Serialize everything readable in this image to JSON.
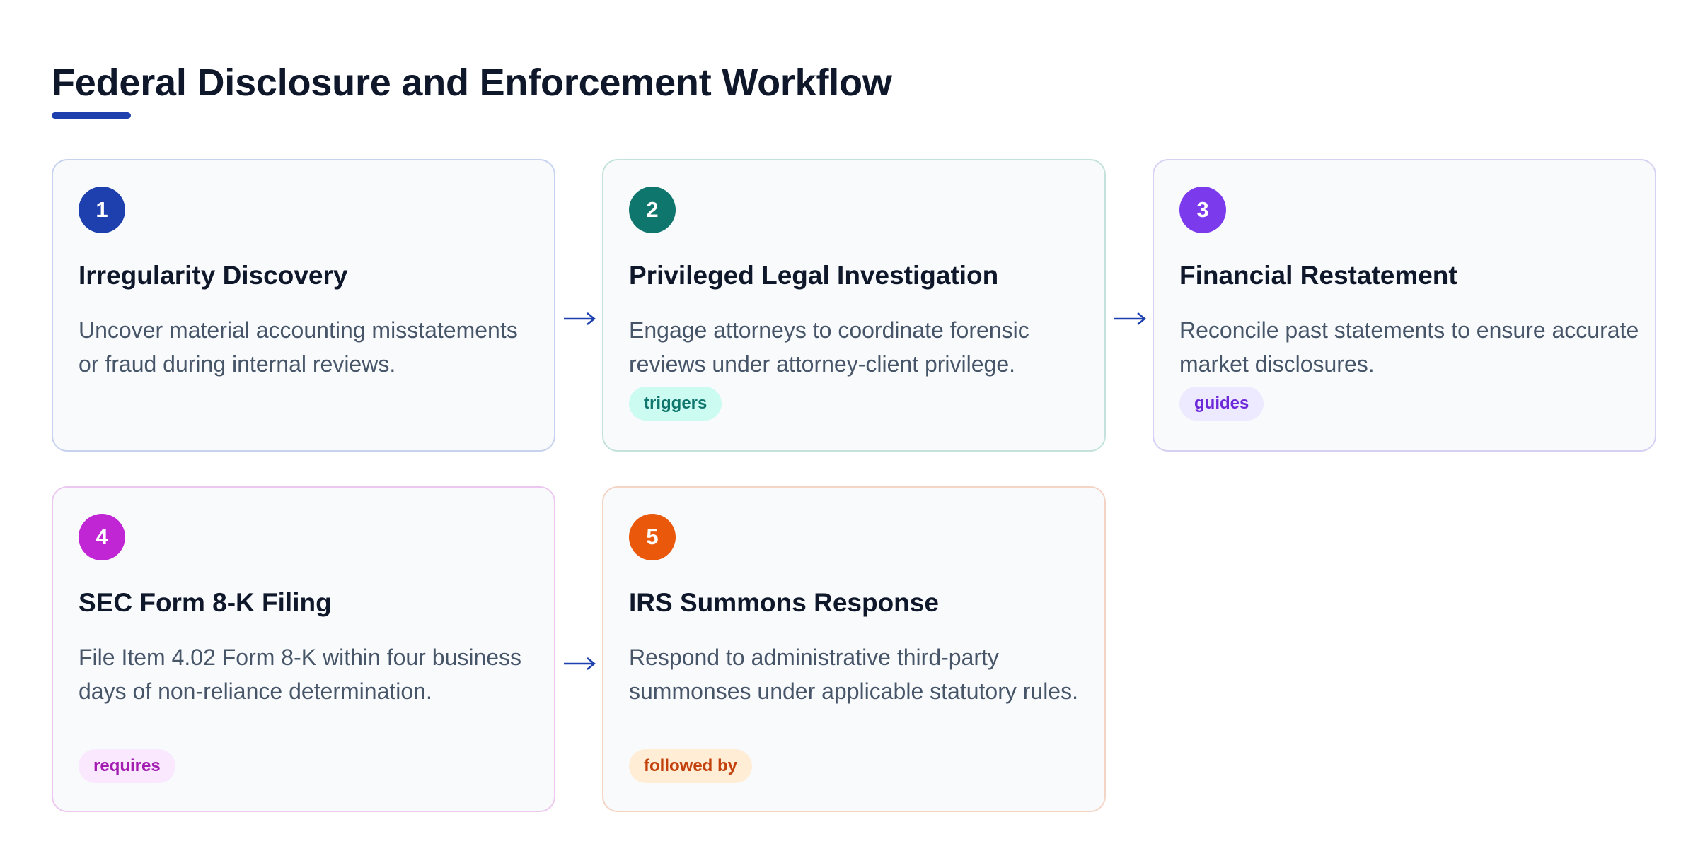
{
  "page": {
    "title": "Federal Disclosure and Enforcement Workflow",
    "accent_color": "#1e40af"
  },
  "steps": [
    {
      "number": "1",
      "title": "Irregularity Discovery",
      "description": "Uncover material accounting misstatements or fraud during internal reviews.",
      "color": "#1e40af"
    },
    {
      "number": "2",
      "title": "Privileged Legal Investigation",
      "description": "Engage attorneys to coordinate forensic reviews under attorney-client privilege.",
      "tag": "triggers",
      "color": "#0f766e"
    },
    {
      "number": "3",
      "title": "Financial Restatement",
      "description": "Reconcile past statements to ensure accurate market disclosures.",
      "tag": "guides",
      "color": "#7c3aed"
    },
    {
      "number": "4",
      "title": "SEC Form 8-K Filing",
      "description": "File Item 4.02 Form 8-K within four business days of non-reliance determination.",
      "tag": "requires",
      "color": "#c026d3"
    },
    {
      "number": "5",
      "title": "IRS Summons Response",
      "description": "Respond to administrative third-party summonses under applicable statutory rules.",
      "tag": "followed by",
      "color": "#ea580c"
    }
  ],
  "connectors": [
    {
      "from": "1",
      "to": "2",
      "icon": "right-arrow-icon"
    },
    {
      "from": "2",
      "to": "3",
      "icon": "right-arrow-icon"
    },
    {
      "from": "4",
      "to": "5",
      "icon": "right-arrow-icon"
    }
  ]
}
